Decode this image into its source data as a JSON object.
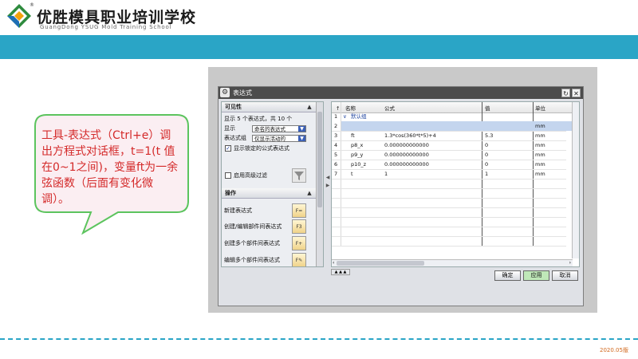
{
  "brand": {
    "title": "优胜模具职业培训学校",
    "subtitle": "GuangDong YSUG Mold Training School",
    "registered": "®"
  },
  "callout": {
    "text": "工具-表达式（Ctrl+e）调出方程式对话框，t=1(t 值在0~1之间)，变量ft为一余弦函数（后面有变化微调）。"
  },
  "dialog": {
    "title": "表达式",
    "left_panel": {
      "visibility_header": "可见性",
      "count_text": "显示 5 个表达式，共 10 个",
      "show_label": "显示",
      "show_value": "命名的表达式",
      "group_label": "表达式组",
      "group_value": "仅显示活动的",
      "show_locked_label": "显示锁定的公式表达式",
      "show_locked_checked": true,
      "advanced_filter_label": "启用高级过滤",
      "advanced_filter_checked": false,
      "operations_header": "操作",
      "actions": [
        {
          "label": "新建表达式",
          "icon": "new-expression-icon"
        },
        {
          "label": "创建/编辑部件间表达式",
          "icon": "edit-interpart-icon"
        },
        {
          "label": "创建多个部件间表达式",
          "icon": "multi-interpart-icon"
        },
        {
          "label": "编辑多个部件间表达式",
          "icon": "edit-multi-interpart-icon"
        }
      ]
    },
    "table": {
      "headers": {
        "index": "↑",
        "name": "名称",
        "formula": "公式",
        "value": "值",
        "unit": "单位"
      },
      "group_row": {
        "index": "1",
        "label": "默认组"
      },
      "rows": [
        {
          "index": "2",
          "name": "",
          "formula": "",
          "value": "",
          "unit": "mm",
          "selected": true
        },
        {
          "index": "3",
          "name": "ft",
          "formula": "1.3*cos(360*t*5)+4",
          "value": "5.3",
          "unit": "mm"
        },
        {
          "index": "4",
          "name": "p8_x",
          "formula": "0.000000000000",
          "value": "0",
          "unit": "mm"
        },
        {
          "index": "5",
          "name": "p9_y",
          "formula": "0.000000000000",
          "value": "0",
          "unit": "mm"
        },
        {
          "index": "6",
          "name": "p10_z",
          "formula": "0.000000000000",
          "value": "0",
          "unit": "mm"
        },
        {
          "index": "7",
          "name": "t",
          "formula": "1",
          "value": "1",
          "unit": "mm"
        }
      ]
    },
    "buttons": {
      "ok": "确定",
      "apply": "应用",
      "cancel": "取消"
    }
  },
  "footer": {
    "version": "2020.05版"
  },
  "colors": {
    "band": "#2aa5c6",
    "callout_border": "#5cc45e",
    "callout_text": "#d42a2a",
    "apply_button": "#bfe8b8"
  }
}
